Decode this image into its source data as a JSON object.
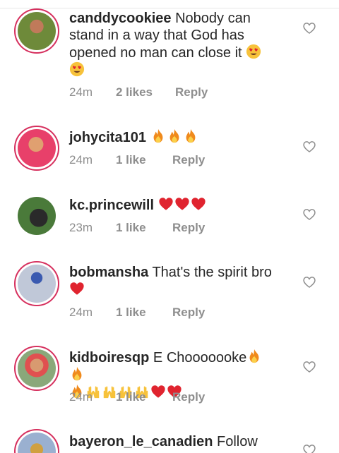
{
  "comments": [
    {
      "username": "canddycookiee",
      "text": " Nobody can stand in a way that God has opened no man can close it",
      "time": "24m",
      "likes": "2 likes",
      "reply": "Reply",
      "avatar_colors": [
        "#7a8a3a",
        "#c07a5a"
      ]
    },
    {
      "username": "johycita101",
      "text": " ",
      "time": "24m",
      "likes": "1 like",
      "reply": "Reply",
      "avatar_colors": [
        "#d8a46a",
        "#e8406a"
      ]
    },
    {
      "username": "kc.princewill",
      "text": " ",
      "time": "23m",
      "likes": "1 like",
      "reply": "Reply",
      "avatar_colors": [
        "#4a7a3a",
        "#2a2a2a"
      ]
    },
    {
      "username": "bobmansha",
      "text": " That's the spirit bro",
      "time": "24m",
      "likes": "1 like",
      "reply": "Reply",
      "avatar_colors": [
        "#c0c8d8",
        "#3a5ab0"
      ]
    },
    {
      "username": "kidboiresqp",
      "text": " E Chooooooke",
      "time": "24m",
      "likes": "1 like",
      "reply": "Reply",
      "avatar_colors": [
        "#8aa87a",
        "#e05050"
      ]
    },
    {
      "username": "bayeron_le_canadien",
      "text": " Follow",
      "avatar_colors": [
        "#9ab0d0",
        "#d0a040"
      ]
    }
  ],
  "icons": {
    "like": "heart-outline-icon",
    "emoji_heart_eyes": "heart-eyes-emoji",
    "emoji_fire": "fire-emoji",
    "emoji_heart": "red-heart-emoji",
    "emoji_raised_hands": "raised-hands-emoji"
  },
  "colors": {
    "story_ring": "#d6305e",
    "meta_gray": "#8e8e8e",
    "text": "#262626",
    "heart_red": "#e0242f",
    "fire_orange": "#f08a1c"
  }
}
